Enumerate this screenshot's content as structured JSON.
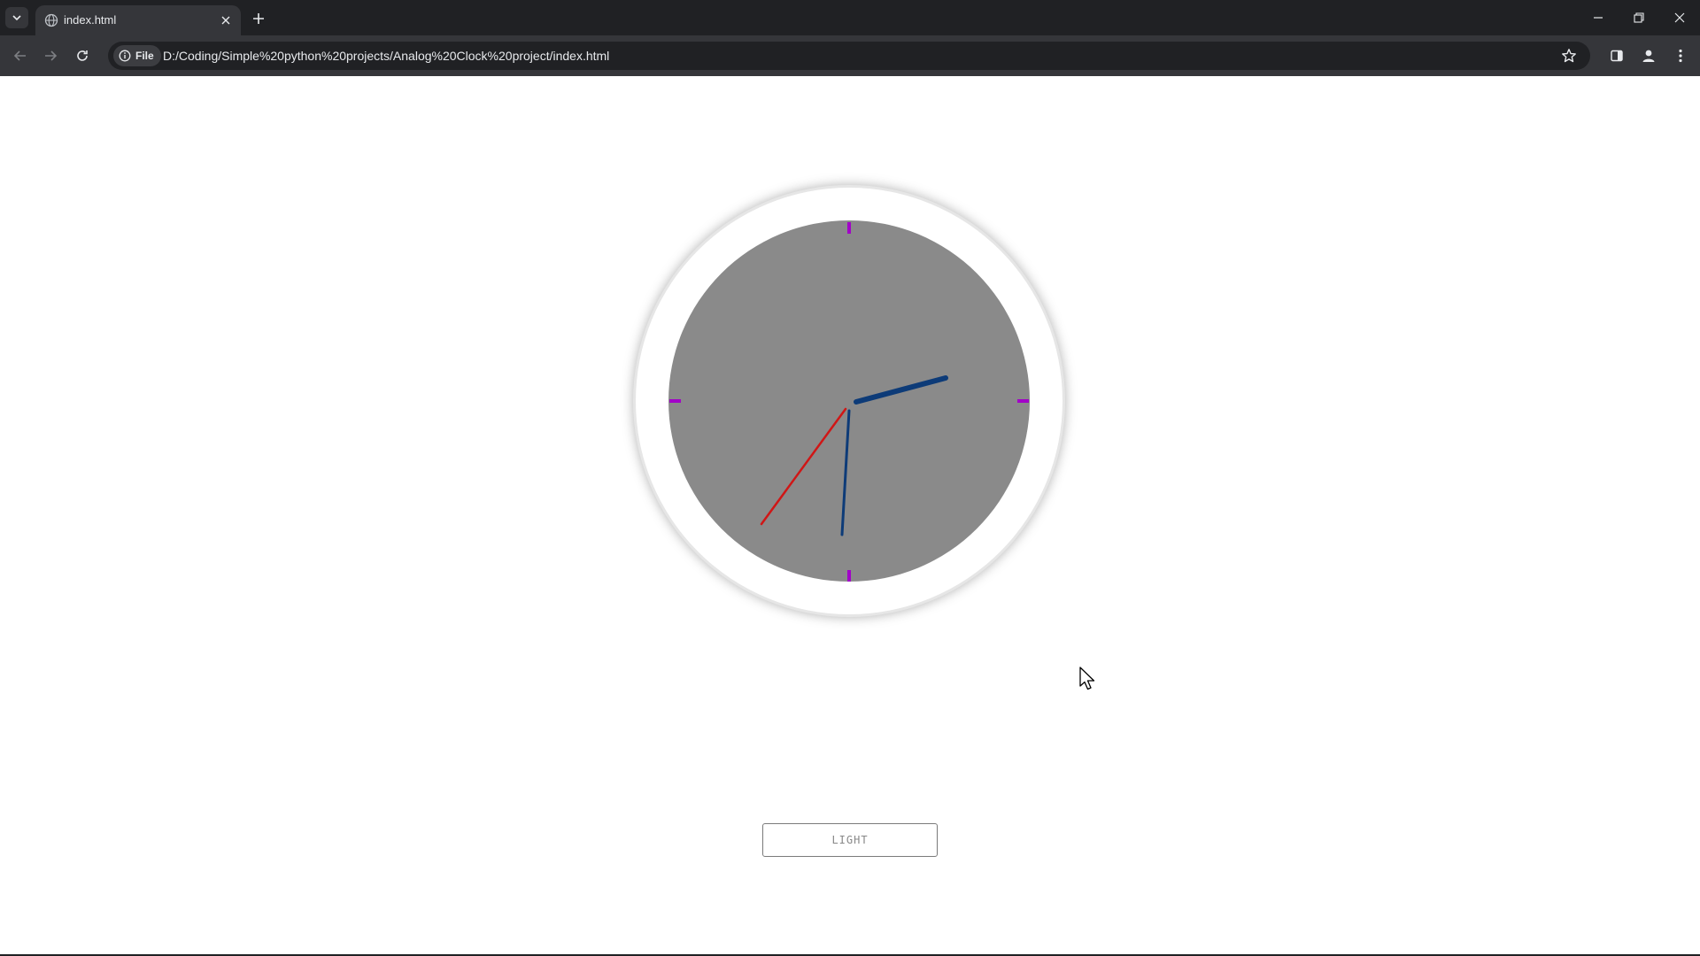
{
  "browser": {
    "tab": {
      "title": "index.html",
      "favicon": "globe-icon"
    },
    "address_bar": {
      "site_chip_label": "File",
      "url": "D:/Coding/Simple%20python%20projects/Analog%20Clock%20project/index.html"
    },
    "icons": {
      "tab_list": "chevron-down-icon",
      "close_tab": "close-icon",
      "new_tab": "plus-icon",
      "back": "arrow-left-icon",
      "forward": "arrow-right-icon",
      "reload": "reload-icon",
      "info": "info-icon",
      "bookmark": "star-icon",
      "side_panel": "side-panel-icon",
      "profile": "profile-icon",
      "menu": "kebab-menu-icon",
      "minimize": "minimize-icon",
      "maximize": "restore-icon",
      "close_window": "close-window-icon"
    },
    "colors": {
      "frame": "#202124",
      "toolbar": "#35363a",
      "omnibox": "#202124",
      "text": "#e8eaed"
    }
  },
  "page": {
    "clock": {
      "face_color": "#8a8a8a",
      "tick_color": "#a200c8",
      "hour_hand_color": "#0d3b78",
      "minute_hand_color": "#0d3b78",
      "second_hand_color": "#d01616"
    },
    "mode_button": {
      "label": "LIGHT"
    }
  }
}
